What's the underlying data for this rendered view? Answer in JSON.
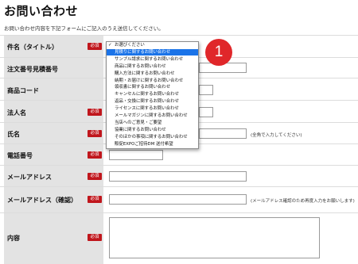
{
  "header": {
    "title": "お問い合わせ",
    "intro": "お問い合わせ内容を下記フォームにご記入のうえ送信してください。"
  },
  "required_label": "必須",
  "form": {
    "rows": [
      {
        "label": "件名（タイトル）",
        "required": true
      },
      {
        "label": "注文番号見積番号",
        "required": false
      },
      {
        "label": "商品コード",
        "required": false
      },
      {
        "label": "法人名",
        "required": true
      },
      {
        "label": "氏名",
        "required": true,
        "hint": "(全角で入力してください)"
      },
      {
        "label": "電話番号",
        "required": true
      },
      {
        "label": "メールアドレス",
        "required": true
      },
      {
        "label": "メールアドレス（確認）",
        "required": true,
        "hint": "(メールアドレス確認のため再度入力をお願いします)"
      },
      {
        "label": "内容",
        "required": true
      }
    ]
  },
  "dropdown": {
    "selected_index": 0,
    "highlighted_index": 1,
    "options": [
      "お選びください",
      "見積りに関するお問い合わせ",
      "サンプル請求に関するお問い合わせ",
      "商品に関するお問い合わせ",
      "購入方法に関するお問い合わせ",
      "納期・お届けに関するお問い合わせ",
      "領収書に関するお問い合わせ",
      "キャンセルに関するお問い合わせ",
      "返品・交換に関するお問い合わせ",
      "ライセンスに関するお問い合わせ",
      "メールマガジンに関するお問い合わせ",
      "当店へのご意見・ご要望",
      "協業に関するお問い合わせ",
      "そのほかの事項に関するお問い合わせ",
      "販促EXPOご招待DM 送付希望"
    ]
  },
  "annotation": {
    "marker": "1",
    "color": "#e0272a"
  },
  "colors": {
    "required_badge": "#c0161c",
    "label_cell": "#e3e3e3",
    "highlight": "#1a73e8"
  }
}
